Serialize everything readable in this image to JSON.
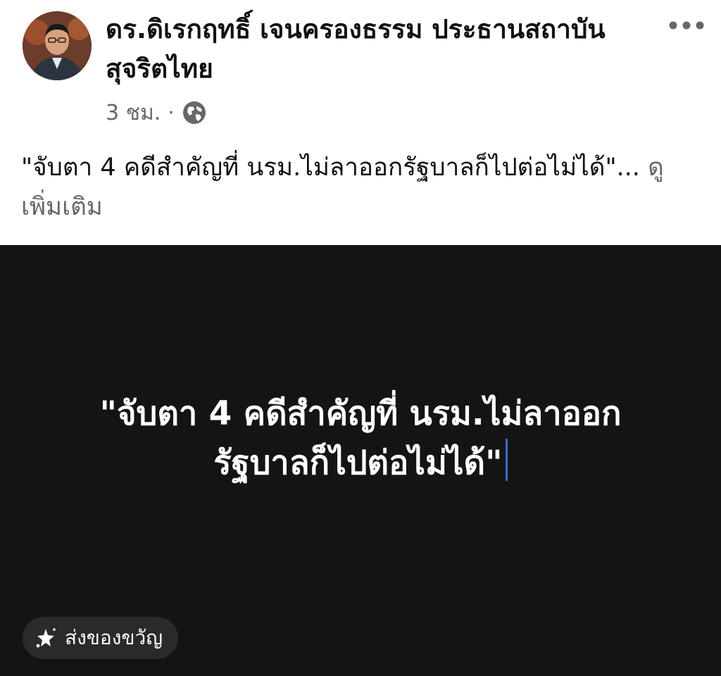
{
  "post": {
    "author_name": "ดร.ดิเรกฤทธิ์ เจนครองธรรม ประธานสถาบันสุจริตไทย",
    "timestamp": "3 ชม.",
    "separator": "·",
    "audience_icon": "globe-icon",
    "more_icon": "more-horizontal-icon",
    "caption_text": "\"จับตา 4 คดีสำคัญที่ นรม.ไม่ลาออกรัฐบาลก็ไปต่อไม่ได้\"...",
    "see_more_label": "ดูเพิ่มเติม"
  },
  "media": {
    "line1": "\"จับตา 4 คดีสำคัญที่ นรม.ไม่ลาออก",
    "line2": "รัฐบาลก็ไปต่อไม่ได้\"",
    "background": "#141414"
  },
  "gift_button": {
    "label": "ส่งของขวัญ",
    "icon": "gift-sparkle-icon"
  },
  "colors": {
    "secondary_text": "#65676b",
    "caret": "#2f6fd6"
  }
}
